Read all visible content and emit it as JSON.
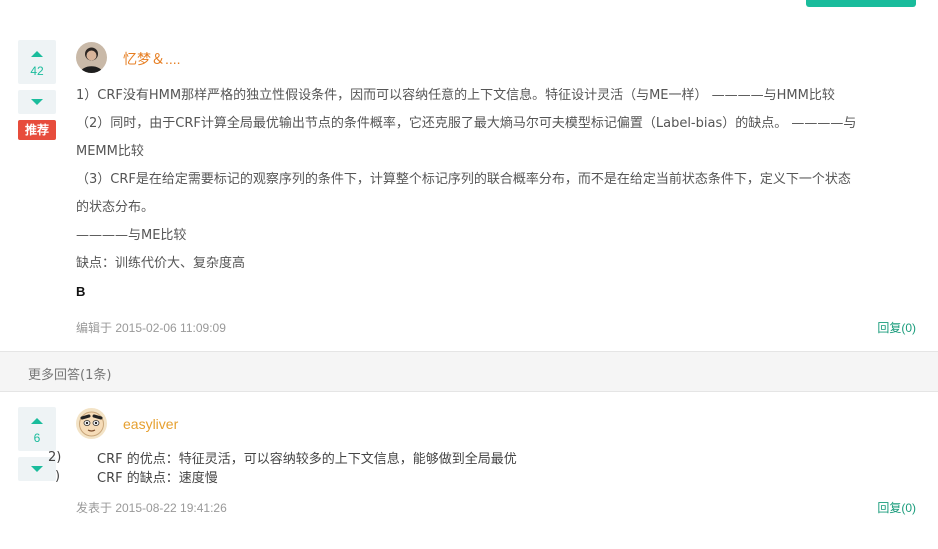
{
  "colors": {
    "accent": "#1abc9c",
    "badge": "#e74c3c",
    "user1": "#e67e22",
    "user2": "#e6a030"
  },
  "answer1": {
    "votes": "42",
    "badge": "推荐",
    "user": "忆梦＆....",
    "lines": [
      "1）CRF没有HMM那样严格的独立性假设条件，因而可以容纳任意的上下文信息。特征设计灵活（与ME一样） ————与HMM比较",
      "（2）同时，由于CRF计算全局最优输出节点的条件概率，它还克服了最大熵马尔可夫模型标记偏置（Label-bias）的缺点。 ————与",
      "MEMM比较",
      "（3）CRF是在给定需要标记的观察序列的条件下，计算整个标记序列的联合概率分布，而不是在给定当前状态条件下，定义下一个状态",
      "的状态分布。",
      "————与ME比较",
      "缺点：训练代价大、复杂度高"
    ],
    "bold_line": "B",
    "meta": "编辑于 2015-02-06 11:09:09",
    "reply": "回复(0)"
  },
  "more_answers": "更多回答(1条)",
  "answer2": {
    "votes": "6",
    "user": "easyliver",
    "side_fragments": [
      "2)",
      ")"
    ],
    "lines": [
      "CRF 的优点：特征灵活，可以容纳较多的上下文信息，能够做到全局最优",
      "CRF 的缺点：速度慢"
    ],
    "meta": "发表于 2015-08-22 19:41:26",
    "reply": "回复(0)"
  }
}
